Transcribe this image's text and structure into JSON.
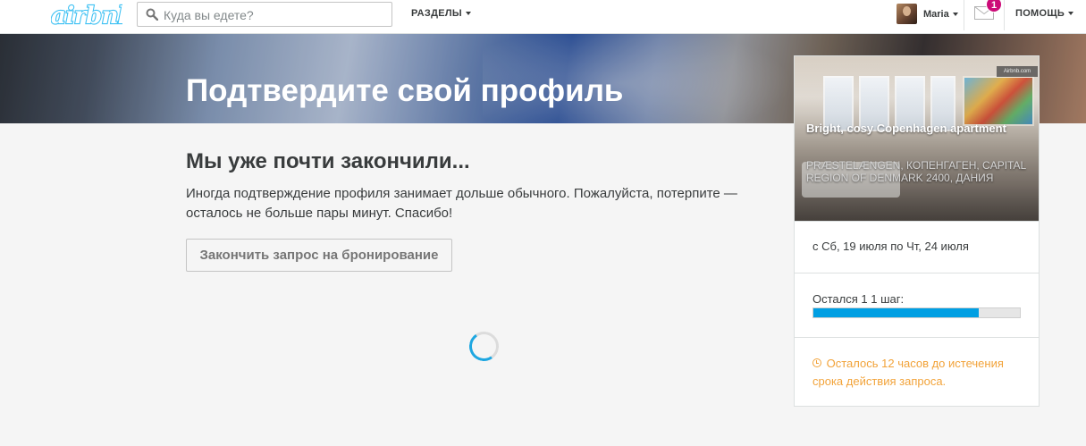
{
  "header": {
    "logo_text": "airbnb",
    "search_placeholder": "Куда вы едете?",
    "sections_label": "РАЗДЕЛЫ",
    "user_name": "Maria",
    "messages_count": "1",
    "help_label": "ПОМОЩЬ"
  },
  "banner": {
    "title": "Подтвердите свой профиль"
  },
  "main": {
    "heading": "Мы уже почти закончили...",
    "text": "Иногда подтверждение профиля занимает дольше обычного. Пожалуйста, потерпите — осталось не больше пары минут. Спасибо!",
    "finish_button": "Закончить запрос на бронирование"
  },
  "sidebar": {
    "listing_title": "Bright, cosy Copenhagen apartment",
    "listing_address": "PRÆSTELÆNGEN, КОПЕНГАГЕН, CAPITAL REGION OF DENMARK 2400, ДАНИЯ",
    "dates": "с Сб, 19 июля по Чт, 24 июля",
    "steps_label": "Остался 1 1 шаг:",
    "progress_fraction": 0.8,
    "expire_text": "Осталось 12 часов до истечения срока действия запроса."
  },
  "colors": {
    "brand": "#FF5A5F",
    "logo": "#3ec1f3",
    "progress": "#009fe3",
    "badge": "#cc0b78",
    "warning": "#f2a33a"
  },
  "icons": [
    "search-icon",
    "caret-down-icon",
    "mail-icon",
    "clock-icon",
    "spinner-icon"
  ]
}
